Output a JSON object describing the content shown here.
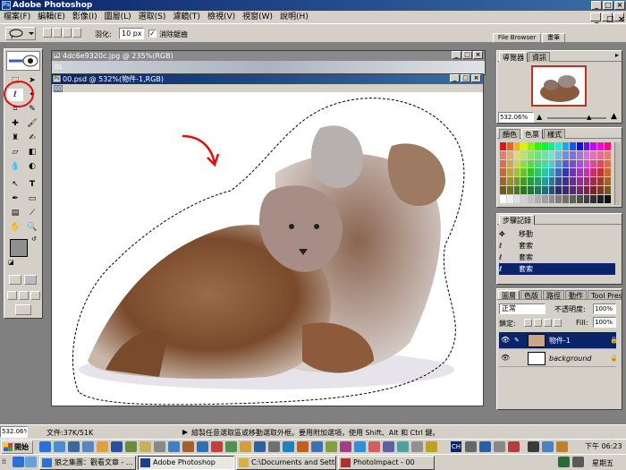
{
  "app": {
    "title": "Adobe Photoshop"
  },
  "menu": [
    "檔案(F)",
    "編輯(E)",
    "影像(I)",
    "圖層(L)",
    "選取(S)",
    "濾鏡(T)",
    "檢視(V)",
    "視窗(W)",
    "說明(H)"
  ],
  "options_bar": {
    "feather_label": "羽化:",
    "feather_value": "10 px",
    "antialias_label": "消除鋸齒",
    "antialias_checked": true,
    "palette_well_tabs": [
      "File Browser",
      "畫筆"
    ]
  },
  "documents": {
    "back_title": "4dc6e9320c.jpg @ 235%(RGB)",
    "back_tab": "01",
    "front_title": "00.psd @ 532%(物件-1,RGB)",
    "front_tab": "00"
  },
  "navigator": {
    "tabs": [
      "導覽器",
      "資訊"
    ],
    "zoom": "532.06%"
  },
  "swatches": {
    "tabs": [
      "顏色",
      "色票",
      "樣式"
    ]
  },
  "history": {
    "tab": "步驟記錄",
    "items": [
      "移動",
      "套索",
      "套索",
      "套索"
    ]
  },
  "layers": {
    "tabs": [
      "圖層",
      "色版",
      "路徑",
      "動作",
      "Tool Presets"
    ],
    "blend_mode": "正常",
    "opacity_label": "不透明度:",
    "opacity_value": "100%",
    "lock_label": "鎖定:",
    "fill_label": "Fill:",
    "fill_value": "100%",
    "rows": [
      {
        "name": "物件-1",
        "selected": true
      },
      {
        "name": "background",
        "selected": false
      }
    ]
  },
  "status": {
    "zoom": "532.06%",
    "doc_info": "文件:37K/51K",
    "hint": "繪製任意選取區或移動選取外框。要用附加選項，使用 Shift、Alt 和 Ctrl 鍵。"
  },
  "taskbar": {
    "start_label": "開始",
    "buttons": [
      "狼之集團：觀看文章 - ...",
      "Adobe Photoshop",
      "C:\\Documents and Setting...",
      "PhotoImpact - 00"
    ],
    "clock_time": "下午 06:23",
    "clock_day": "星期五"
  },
  "colors": {
    "title_active": "#0a246a",
    "title_inactive": "#808080",
    "selection_highlight": "#0a246a",
    "annotation_red": "#e01010"
  }
}
